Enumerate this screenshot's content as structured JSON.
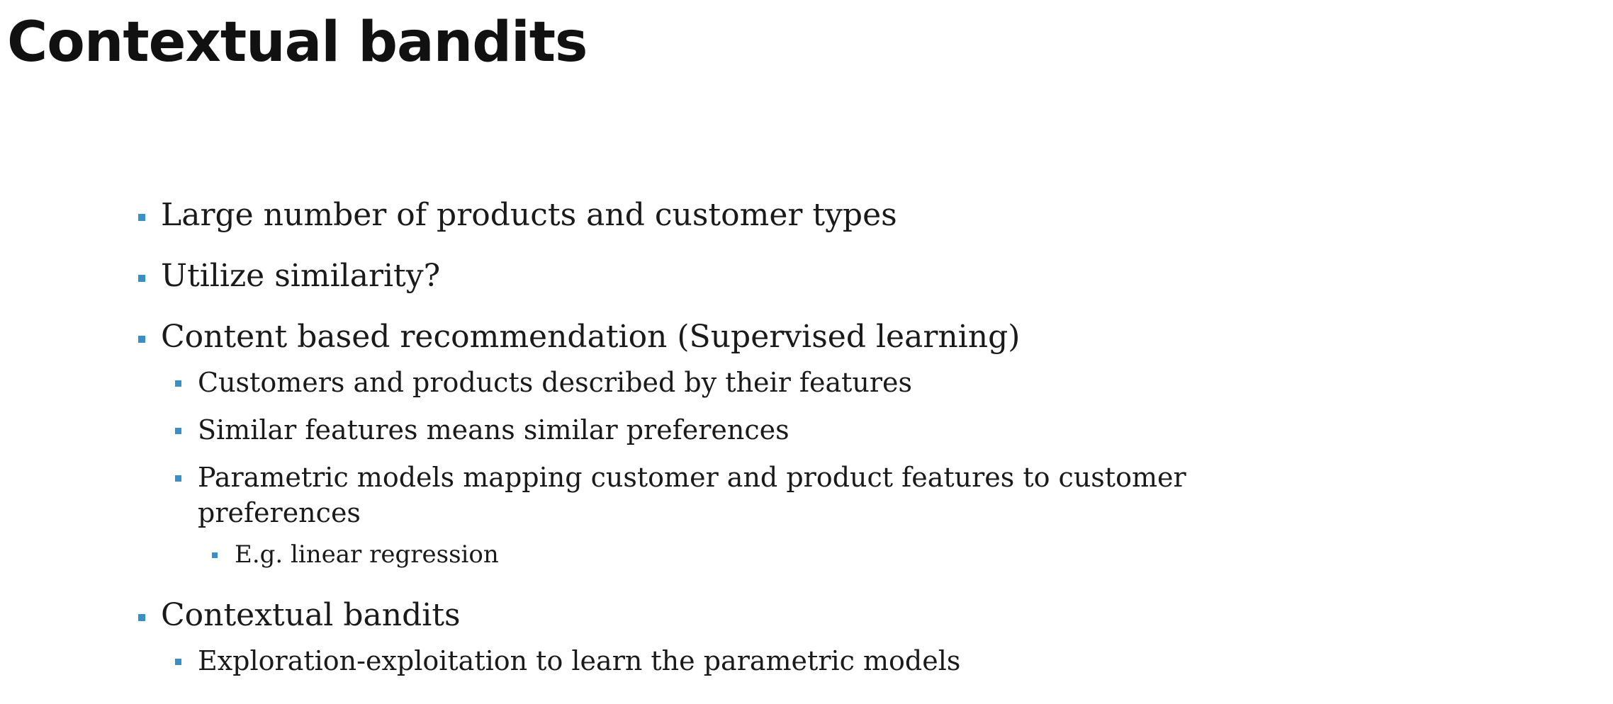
{
  "slide": {
    "title": "Contextual bandits",
    "bullets": [
      {
        "level": 1,
        "text": "Large number of products and customer types"
      },
      {
        "level": 1,
        "text": "Utilize similarity?"
      },
      {
        "level": 1,
        "text": "Content based recommendation (Supervised learning)"
      },
      {
        "level": 2,
        "text": "Customers and products described by their features"
      },
      {
        "level": 2,
        "text": "Similar features means similar preferences"
      },
      {
        "level": 2,
        "text": "Parametric models mapping customer and product features to customer preferences"
      },
      {
        "level": 3,
        "text": "E.g. linear regression"
      },
      {
        "level": 1,
        "text": "Contextual bandits"
      },
      {
        "level": 2,
        "text": "Exploration-exploitation to learn the parametric models"
      }
    ]
  },
  "colors": {
    "bullet_marker": "#3a8fc8",
    "text": "#1a1a1a",
    "background": "#ffffff"
  }
}
